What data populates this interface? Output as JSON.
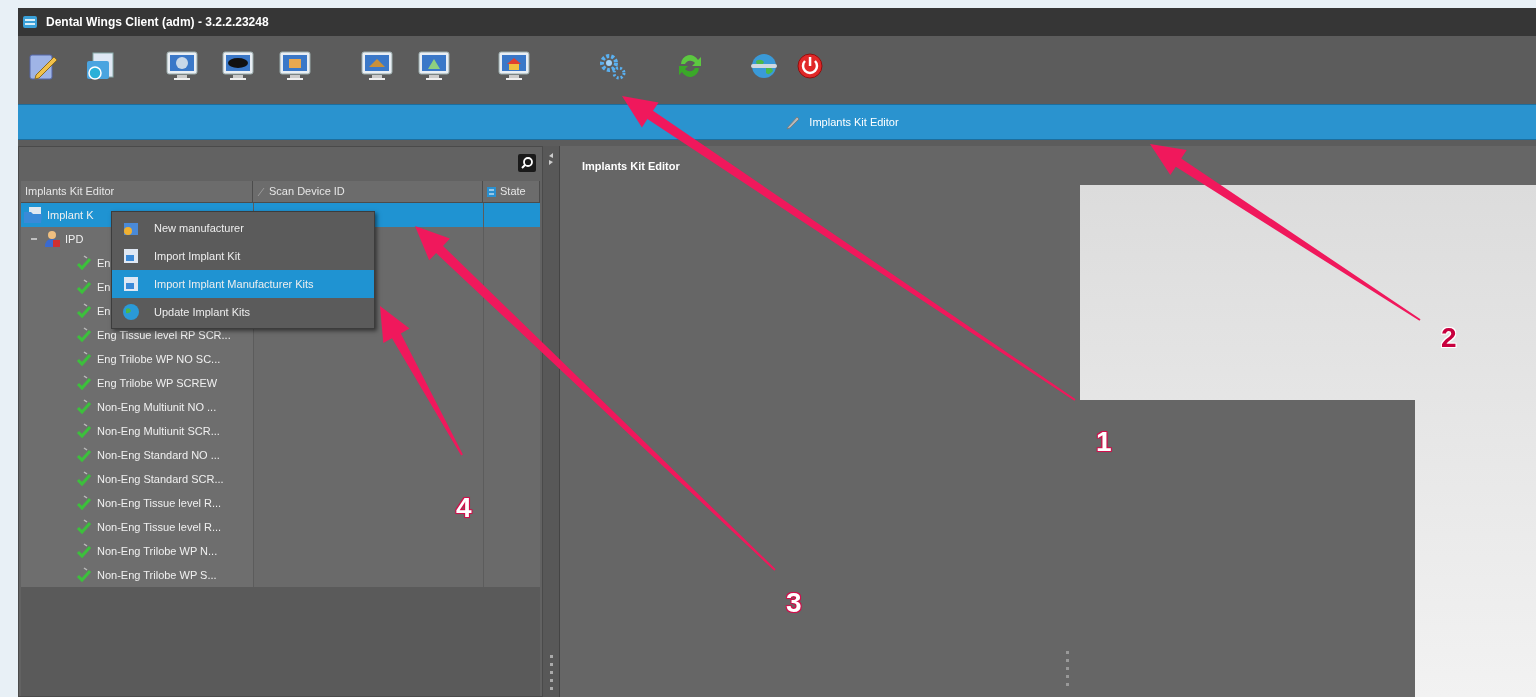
{
  "window": {
    "title": "Dental Wings Client (adm) - 3.2.2.23248"
  },
  "header_bar": {
    "title": "Implants Kit Editor"
  },
  "left_panel": {
    "columns": [
      {
        "label": "Implants Kit Editor"
      },
      {
        "label": "Scan Device ID"
      },
      {
        "label": "State"
      }
    ],
    "tree": [
      {
        "label": "Implant K",
        "selected": true,
        "children": [
          {
            "label": "IPD",
            "selected": false,
            "expanded": true,
            "children": [
              {
                "label": "En",
                "selected": false
              },
              {
                "label": "En",
                "selected": false
              },
              {
                "label": "En",
                "selected": false
              },
              {
                "label": "Eng Tissue level RP SCR...",
                "selected": false
              },
              {
                "label": "Eng Trilobe WP NO SC...",
                "selected": false
              },
              {
                "label": "Eng Trilobe WP SCREW",
                "selected": false
              },
              {
                "label": "Non-Eng Multiunit NO ...",
                "selected": false
              },
              {
                "label": "Non-Eng Multiunit SCR...",
                "selected": false
              },
              {
                "label": "Non-Eng Standard NO ...",
                "selected": false
              },
              {
                "label": "Non-Eng Standard SCR...",
                "selected": false
              },
              {
                "label": "Non-Eng Tissue level R...",
                "selected": false
              },
              {
                "label": "Non-Eng Tissue level R...",
                "selected": false
              },
              {
                "label": "Non-Eng Trilobe WP N...",
                "selected": false
              },
              {
                "label": "Non-Eng Trilobe WP S...",
                "selected": false
              }
            ]
          }
        ]
      }
    ]
  },
  "context_menu": {
    "items": [
      {
        "label": "New manufacturer",
        "selected": false
      },
      {
        "label": "Import Implant Kit",
        "selected": false
      },
      {
        "label": "Import Implant Manufacturer Kits",
        "selected": true
      },
      {
        "label": "Update Implant Kits",
        "selected": false
      }
    ]
  },
  "right_panel": {
    "title": "Implants Kit Editor"
  },
  "annotations": [
    {
      "label": "1"
    },
    {
      "label": "2"
    },
    {
      "label": "3"
    },
    {
      "label": "4"
    }
  ]
}
